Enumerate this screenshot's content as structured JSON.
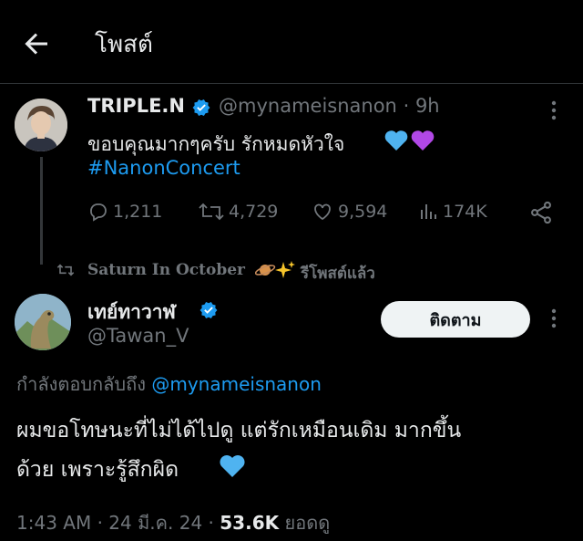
{
  "header": {
    "title": "โพสต์",
    "back_icon": "arrow-left-icon"
  },
  "tweet1": {
    "display_name": "TRIPLE.N",
    "verified": true,
    "handle": "@mynameisnanon",
    "separator": "·",
    "time": "9h",
    "text": "ขอบคุณมากๆครับ รักหมดหัวใจ",
    "hearts": [
      "blue-heart",
      "purple-heart"
    ],
    "hashtag": "#NanonConcert",
    "actions": {
      "replies": "1,211",
      "reposts": "4,729",
      "likes": "9,594",
      "views": "174K"
    }
  },
  "repost_line": {
    "name": "Saturn In October",
    "emoji": [
      "ringed-planet",
      "sparkles"
    ],
    "suffix": "รีโพสต์แล้ว"
  },
  "tweet2": {
    "display_name": "เทย์ทาวาฬ",
    "verified": true,
    "handle": "@Tawan_V",
    "follow_label": "ติดตาม",
    "reply_prefix": "กำลังตอบกลับถึง",
    "reply_target": "@mynameisnanon",
    "text_line1": "ผมขอโทษนะที่ไม่ได้ไปดู แต่รักเหมือนเดิม มากขึ้น",
    "text_line2": "ด้วย เพราะรู้สึกผิด",
    "heart": "blue-heart",
    "time": "1:43 AM",
    "date": "24 มี.ค. 24",
    "views_count": "53.6K",
    "views_label": "ยอดดู"
  },
  "colors": {
    "background": "#000000",
    "text": "#e7e9ea",
    "muted": "#71767b",
    "link": "#1d9bf0",
    "verified": "#1d9bf0",
    "follow_bg": "#eff3f4"
  }
}
